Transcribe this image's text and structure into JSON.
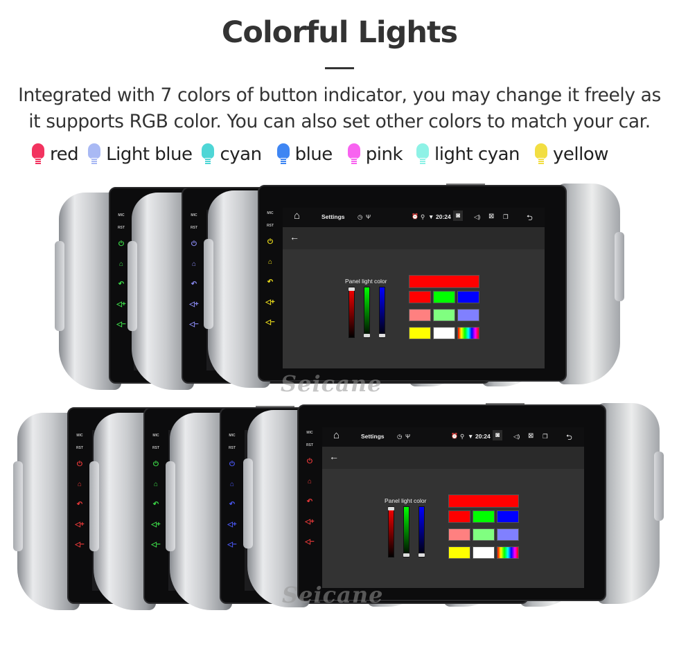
{
  "header": {
    "title": "Colorful Lights",
    "description": [
      "Integrated with 7 colors of button indicator, you may change it freely as",
      "it supports RGB color. You can also set other colors to match your car."
    ]
  },
  "legend": [
    {
      "label": "red",
      "color": "#f2335f"
    },
    {
      "label": "Light blue",
      "color": "#a9b9f4"
    },
    {
      "label": "cyan",
      "color": "#4ed6d6"
    },
    {
      "label": "blue",
      "color": "#3f86f3"
    },
    {
      "label": "pink",
      "color": "#f863f0"
    },
    {
      "label": "light cyan",
      "color": "#8ef2e6"
    },
    {
      "label": "yellow",
      "color": "#f2de42"
    }
  ],
  "units": {
    "top_row_led_colors": [
      "#3ee04a",
      "#8c8cf5",
      "#f2e21a"
    ],
    "bottom_row_led_colors": [
      "#f03a3a",
      "#3ee04a",
      "#4a58f5",
      "#f03a3a"
    ],
    "panel_labels": {
      "mic": "MIC",
      "rst": "RST"
    }
  },
  "screen": {
    "app_title": "Settings",
    "time": "20:24",
    "panel_title": "Panel light color",
    "slider_levels": {
      "red": 1.0,
      "green": 0.0,
      "blue": 0.0
    },
    "selected_color": "#ff0000",
    "swatches": [
      "#ff0000",
      "#00ff00",
      "#0000ff",
      "#ff8080",
      "#80ff80",
      "#8080ff",
      "#ffff00",
      "#ffffff",
      "rainbow"
    ]
  },
  "watermark": "Seicane"
}
